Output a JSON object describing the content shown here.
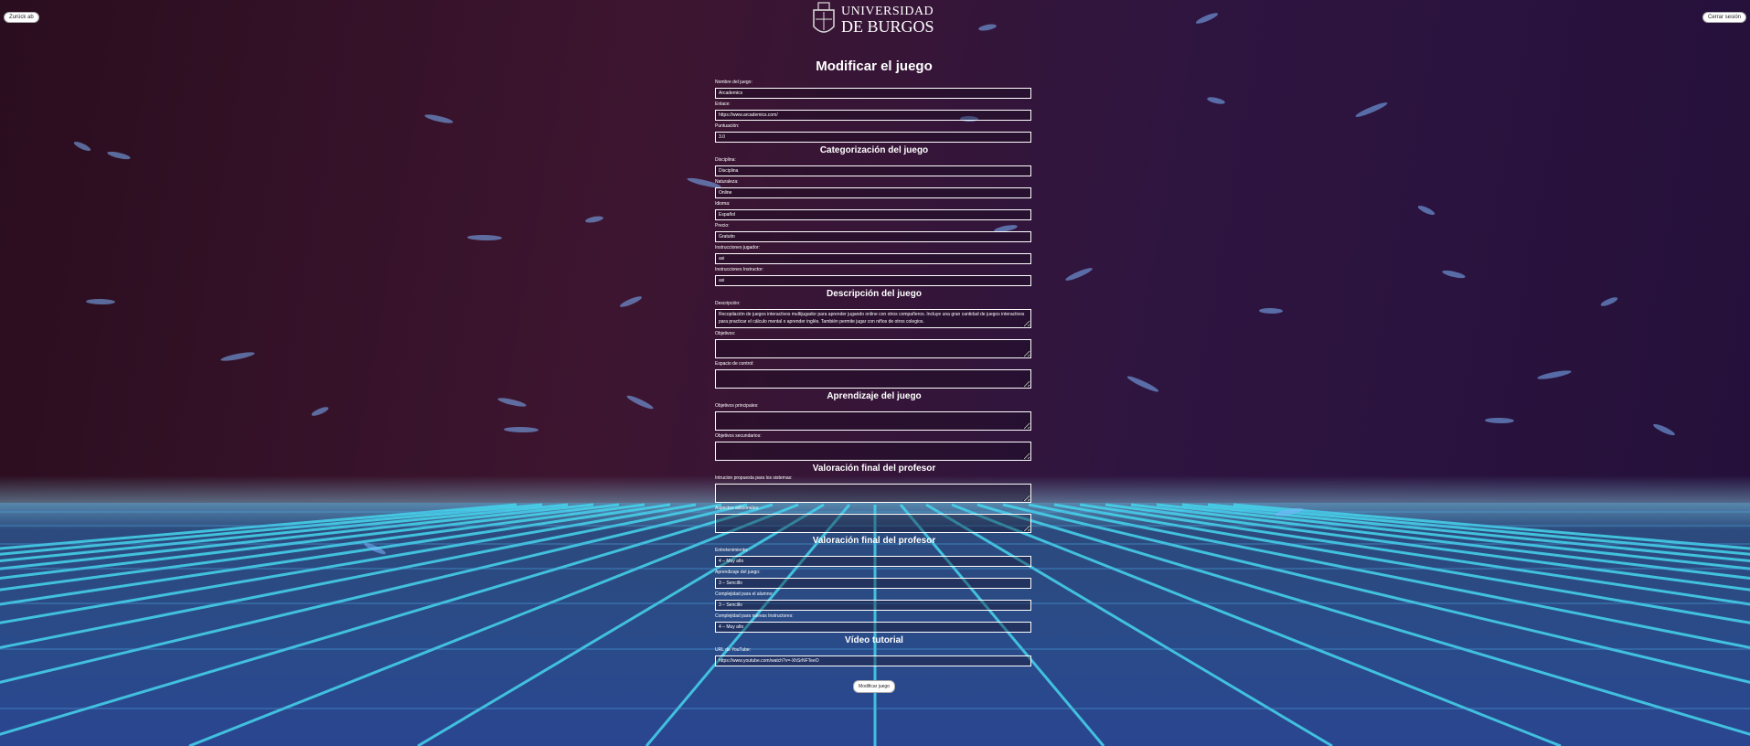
{
  "header": {
    "left_button": "Zurück ab",
    "right_button": "Cerrar sesión",
    "logo_line1": "UNIVERSIDAD",
    "logo_line2": "DE BURGOS"
  },
  "page": {
    "title": "Modificar el juego",
    "submit": "Modificar juego"
  },
  "basic": {
    "nombre": {
      "label": "Nombre del juego:",
      "value": "Arcademics"
    },
    "enlace": {
      "label": "Enlace:",
      "value": "https://www.arcademics.com/"
    },
    "puntuacion": {
      "label": "Puntuación:",
      "value": "3.0"
    }
  },
  "categorizacion": {
    "title": "Categorización del juego",
    "disciplina": {
      "label": "Disciplina:",
      "value": "Disciplina"
    },
    "naturaleza": {
      "label": "Naturaleza:",
      "value": "Online"
    },
    "idioma": {
      "label": "Idioma:",
      "value": "Español"
    },
    "precio": {
      "label": "Precio:",
      "value": "Gratuito"
    },
    "instr_jugador": {
      "label": "Instrucciones jugador:",
      "value": "asi"
    },
    "instr_instructor": {
      "label": "Instrucciones Instructor:",
      "value": "asi"
    }
  },
  "descripcion": {
    "title": "Descripción del juego",
    "descripcion": {
      "label": "Descripción:",
      "value": "Recopilación de juegos interactivos multijugador para aprender jugando online con otros compañeros. Incluye una gran cantidad de juegos interactivos para practicar el cálculo mental o aprender inglés. También permite jugar con niños de otros colegios."
    },
    "objetivos": {
      "label": "Objetivos:",
      "value": ""
    },
    "espacio": {
      "label": "Espacio de control:",
      "value": ""
    }
  },
  "aprendizaje": {
    "title": "Aprendizaje del juego",
    "obj_principales": {
      "label": "Objetivos principales:",
      "value": ""
    },
    "obj_secundarios": {
      "label": "Objetivos secundarios:",
      "value": ""
    }
  },
  "valoracion1": {
    "title": "Valoración final del profesor",
    "mejoras": {
      "label": "Intrucion propuesta para los sistemas:",
      "value": ""
    },
    "aspectos": {
      "label": "Aspectos adicionales:",
      "value": ""
    }
  },
  "valoracion2": {
    "title": "Valoración final del profesor",
    "entretenimiento": {
      "label": "Entretenimiento:",
      "value": "4 – Muy alto"
    },
    "aprendizaje": {
      "label": "Aprendizaje del juego:",
      "value": "3 – Sencillo"
    },
    "complejidad_alumno": {
      "label": "Complejidad para el alumno:",
      "value": "3 – Sencillo"
    },
    "complejidad_instr": {
      "label": "Complejidad para nuevas Instructores:",
      "value": "4 – Muy alto"
    }
  },
  "video": {
    "title": "Vídeo tutorial",
    "url": {
      "label": "URL de YouTube:",
      "value": "https://www.youtube.com/watch?v=-XhSrNFTeeO"
    }
  },
  "colors": {
    "accent_grid": "#3fd8f0",
    "bg_top": "#2e1235",
    "floor": "#2a4b8a"
  }
}
